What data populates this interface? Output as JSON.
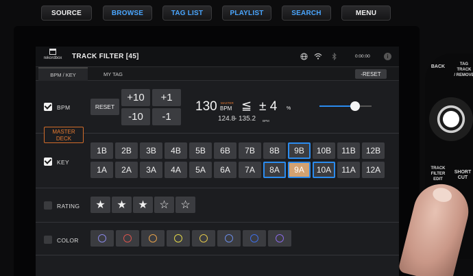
{
  "hardware": {
    "top_buttons": [
      {
        "label": "SOURCE",
        "color": "white"
      },
      {
        "label": "BROWSE",
        "color": "blue"
      },
      {
        "label": "TAG LIST",
        "color": "blue"
      },
      {
        "label": "PLAYLIST",
        "color": "blue"
      },
      {
        "label": "SEARCH",
        "color": "blue"
      },
      {
        "label": "MENU",
        "color": "white"
      }
    ],
    "right_buttons": {
      "back": "BACK",
      "tag_track_remove_1": "TAG TRACK",
      "tag_track_remove_2": "/ REMOVE",
      "track_filter_1": "TRACK",
      "track_filter_2": "FILTER",
      "track_filter_3": "EDIT",
      "short_cut_1": "SHORT",
      "short_cut_2": "CUT"
    }
  },
  "screen": {
    "logo_text": "rekordbox",
    "title": "TRACK FILTER  [45]",
    "clock": "0:00:00",
    "info_icon": "i",
    "tabs": [
      "BPM / KEY",
      "MY TAG"
    ],
    "reset_all": "-RESET",
    "bpm": {
      "label": "BPM",
      "checked": true,
      "reset": "RESET",
      "steps": [
        "+10",
        "+1",
        "-10",
        "-1"
      ],
      "value": "130",
      "master": "MASTER",
      "unit": "BPM",
      "le": "≦",
      "pm": "± 4",
      "pct": "%",
      "range_low": "124.8",
      "range_high": "135.2",
      "range_unit": "BPM",
      "slider_fraction": 0.68
    },
    "master_deck": {
      "line1": "MASTER",
      "line2": "DECK"
    },
    "key": {
      "label": "KEY",
      "checked": true,
      "row1": [
        "1B",
        "2B",
        "3B",
        "4B",
        "5B",
        "6B",
        "7B",
        "8B",
        "9B",
        "10B",
        "11B",
        "12B"
      ],
      "row2": [
        "1A",
        "2A",
        "3A",
        "4A",
        "5A",
        "6A",
        "7A",
        "8A",
        "9A",
        "10A",
        "11A",
        "12A"
      ],
      "selected": [
        "9B",
        "8A",
        "10A"
      ],
      "current": "9A"
    },
    "rating": {
      "label": "RATING",
      "checked": false,
      "stars": [
        "★",
        "★",
        "★",
        "☆",
        "☆"
      ]
    },
    "color": {
      "label": "COLOR",
      "checked": false,
      "swatches": [
        "#8a88e8",
        "#d9544d",
        "#e8a24a",
        "#e4d94a",
        "#e4c84a",
        "#6c8de8",
        "#3e6fe8",
        "#8a6ae8"
      ]
    },
    "colors": {
      "accent": "#2b8cf0",
      "master": "#e8782f",
      "current_key": "#d3a271"
    }
  }
}
